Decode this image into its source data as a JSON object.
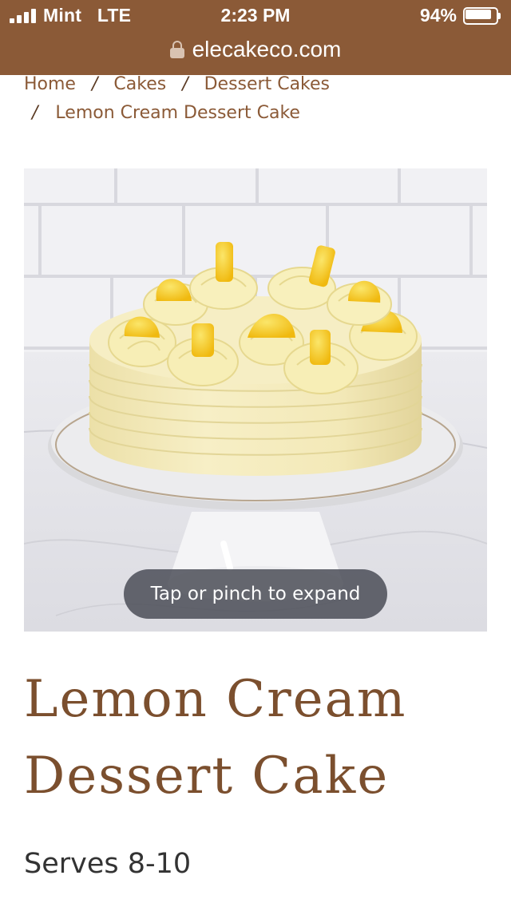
{
  "status_bar": {
    "carrier": "Mint",
    "network": "LTE",
    "time": "2:23 PM",
    "battery": "94%",
    "battery_level": 0.94
  },
  "browser": {
    "domain": "elecakeco.com"
  },
  "breadcrumb": {
    "items": [
      "Home",
      "Cakes",
      "Dessert Cakes",
      "Lemon Cream Dessert Cake"
    ],
    "separator": "/"
  },
  "product": {
    "image_hint": "Tap or pinch to expand",
    "title": "Lemon Cream Dessert Cake",
    "serves": "Serves 8-10"
  },
  "colors": {
    "brand": "#8b5a37",
    "title": "#7b4f2e",
    "frosting": "#f3eab8",
    "lemon": "#f2c41c"
  }
}
